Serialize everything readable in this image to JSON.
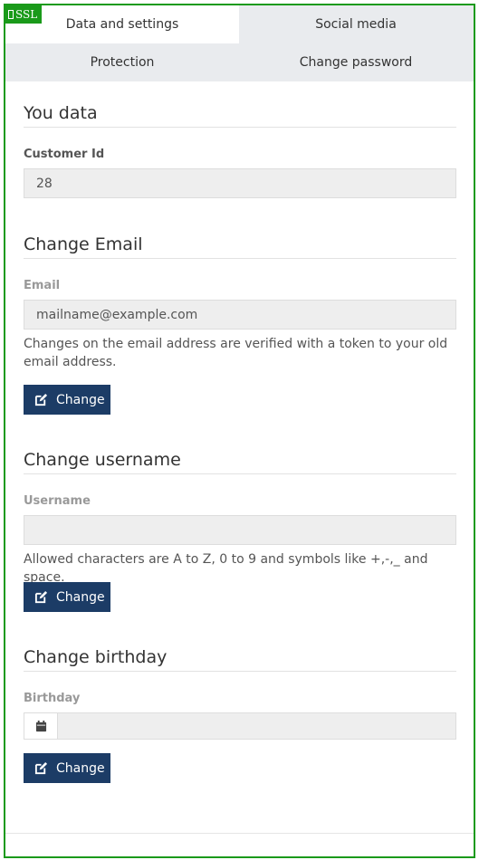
{
  "ssl_badge": {
    "label": "SSL",
    "icon": "lock-icon"
  },
  "tabs": [
    {
      "label": "Data and settings",
      "active": true
    },
    {
      "label": "Social media",
      "active": false
    },
    {
      "label": "Protection",
      "active": false
    },
    {
      "label": "Change password",
      "active": false
    }
  ],
  "your_data": {
    "title": "You data",
    "customer_id_label": "Customer Id",
    "customer_id_value": "28"
  },
  "email": {
    "title": "Change Email",
    "label": "Email",
    "placeholder": "mailname@example.com",
    "help": "Changes on the email address are verified with a token to your old email address.",
    "button": "Change",
    "button_icon": "edit-icon"
  },
  "username": {
    "title": "Change username",
    "label": "Username",
    "value": "",
    "help": "Allowed characters are A to Z, 0 to 9 and symbols like +,-,_ and space.",
    "button": "Change",
    "button_icon": "edit-icon"
  },
  "birthday": {
    "title": "Change birthday",
    "label": "Birthday",
    "addon_icon": "calendar-icon",
    "value": "",
    "button": "Change",
    "button_icon": "edit-icon"
  },
  "colors": {
    "frame_border": "#1a9a1a",
    "button_bg": "#1c3c66",
    "tab_bar_bg": "#e9ebee"
  }
}
